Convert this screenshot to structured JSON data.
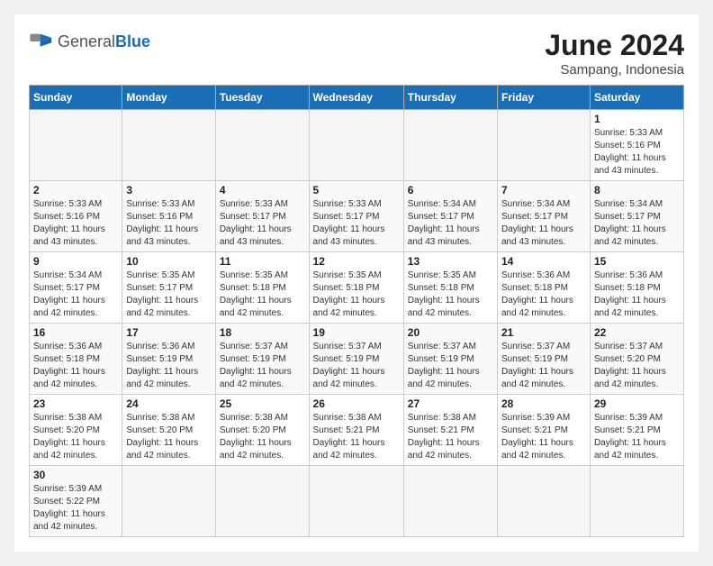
{
  "header": {
    "logo_general": "General",
    "logo_blue": "Blue",
    "month_title": "June 2024",
    "location": "Sampang, Indonesia"
  },
  "weekdays": [
    "Sunday",
    "Monday",
    "Tuesday",
    "Wednesday",
    "Thursday",
    "Friday",
    "Saturday"
  ],
  "days": [
    {
      "date": null,
      "number": "",
      "sunrise": "",
      "sunset": "",
      "daylight": ""
    },
    {
      "date": null,
      "number": "",
      "sunrise": "",
      "sunset": "",
      "daylight": ""
    },
    {
      "date": null,
      "number": "",
      "sunrise": "",
      "sunset": "",
      "daylight": ""
    },
    {
      "date": null,
      "number": "",
      "sunrise": "",
      "sunset": "",
      "daylight": ""
    },
    {
      "date": null,
      "number": "",
      "sunrise": "",
      "sunset": "",
      "daylight": ""
    },
    {
      "date": null,
      "number": "",
      "sunrise": "",
      "sunset": "",
      "daylight": ""
    },
    {
      "date": 1,
      "number": "1",
      "sunrise": "Sunrise: 5:33 AM",
      "sunset": "Sunset: 5:16 PM",
      "daylight": "Daylight: 11 hours and 43 minutes."
    },
    {
      "date": 2,
      "number": "2",
      "sunrise": "Sunrise: 5:33 AM",
      "sunset": "Sunset: 5:16 PM",
      "daylight": "Daylight: 11 hours and 43 minutes."
    },
    {
      "date": 3,
      "number": "3",
      "sunrise": "Sunrise: 5:33 AM",
      "sunset": "Sunset: 5:16 PM",
      "daylight": "Daylight: 11 hours and 43 minutes."
    },
    {
      "date": 4,
      "number": "4",
      "sunrise": "Sunrise: 5:33 AM",
      "sunset": "Sunset: 5:17 PM",
      "daylight": "Daylight: 11 hours and 43 minutes."
    },
    {
      "date": 5,
      "number": "5",
      "sunrise": "Sunrise: 5:33 AM",
      "sunset": "Sunset: 5:17 PM",
      "daylight": "Daylight: 11 hours and 43 minutes."
    },
    {
      "date": 6,
      "number": "6",
      "sunrise": "Sunrise: 5:34 AM",
      "sunset": "Sunset: 5:17 PM",
      "daylight": "Daylight: 11 hours and 43 minutes."
    },
    {
      "date": 7,
      "number": "7",
      "sunrise": "Sunrise: 5:34 AM",
      "sunset": "Sunset: 5:17 PM",
      "daylight": "Daylight: 11 hours and 43 minutes."
    },
    {
      "date": 8,
      "number": "8",
      "sunrise": "Sunrise: 5:34 AM",
      "sunset": "Sunset: 5:17 PM",
      "daylight": "Daylight: 11 hours and 42 minutes."
    },
    {
      "date": 9,
      "number": "9",
      "sunrise": "Sunrise: 5:34 AM",
      "sunset": "Sunset: 5:17 PM",
      "daylight": "Daylight: 11 hours and 42 minutes."
    },
    {
      "date": 10,
      "number": "10",
      "sunrise": "Sunrise: 5:35 AM",
      "sunset": "Sunset: 5:17 PM",
      "daylight": "Daylight: 11 hours and 42 minutes."
    },
    {
      "date": 11,
      "number": "11",
      "sunrise": "Sunrise: 5:35 AM",
      "sunset": "Sunset: 5:18 PM",
      "daylight": "Daylight: 11 hours and 42 minutes."
    },
    {
      "date": 12,
      "number": "12",
      "sunrise": "Sunrise: 5:35 AM",
      "sunset": "Sunset: 5:18 PM",
      "daylight": "Daylight: 11 hours and 42 minutes."
    },
    {
      "date": 13,
      "number": "13",
      "sunrise": "Sunrise: 5:35 AM",
      "sunset": "Sunset: 5:18 PM",
      "daylight": "Daylight: 11 hours and 42 minutes."
    },
    {
      "date": 14,
      "number": "14",
      "sunrise": "Sunrise: 5:36 AM",
      "sunset": "Sunset: 5:18 PM",
      "daylight": "Daylight: 11 hours and 42 minutes."
    },
    {
      "date": 15,
      "number": "15",
      "sunrise": "Sunrise: 5:36 AM",
      "sunset": "Sunset: 5:18 PM",
      "daylight": "Daylight: 11 hours and 42 minutes."
    },
    {
      "date": 16,
      "number": "16",
      "sunrise": "Sunrise: 5:36 AM",
      "sunset": "Sunset: 5:18 PM",
      "daylight": "Daylight: 11 hours and 42 minutes."
    },
    {
      "date": 17,
      "number": "17",
      "sunrise": "Sunrise: 5:36 AM",
      "sunset": "Sunset: 5:19 PM",
      "daylight": "Daylight: 11 hours and 42 minutes."
    },
    {
      "date": 18,
      "number": "18",
      "sunrise": "Sunrise: 5:37 AM",
      "sunset": "Sunset: 5:19 PM",
      "daylight": "Daylight: 11 hours and 42 minutes."
    },
    {
      "date": 19,
      "number": "19",
      "sunrise": "Sunrise: 5:37 AM",
      "sunset": "Sunset: 5:19 PM",
      "daylight": "Daylight: 11 hours and 42 minutes."
    },
    {
      "date": 20,
      "number": "20",
      "sunrise": "Sunrise: 5:37 AM",
      "sunset": "Sunset: 5:19 PM",
      "daylight": "Daylight: 11 hours and 42 minutes."
    },
    {
      "date": 21,
      "number": "21",
      "sunrise": "Sunrise: 5:37 AM",
      "sunset": "Sunset: 5:19 PM",
      "daylight": "Daylight: 11 hours and 42 minutes."
    },
    {
      "date": 22,
      "number": "22",
      "sunrise": "Sunrise: 5:37 AM",
      "sunset": "Sunset: 5:20 PM",
      "daylight": "Daylight: 11 hours and 42 minutes."
    },
    {
      "date": 23,
      "number": "23",
      "sunrise": "Sunrise: 5:38 AM",
      "sunset": "Sunset: 5:20 PM",
      "daylight": "Daylight: 11 hours and 42 minutes."
    },
    {
      "date": 24,
      "number": "24",
      "sunrise": "Sunrise: 5:38 AM",
      "sunset": "Sunset: 5:20 PM",
      "daylight": "Daylight: 11 hours and 42 minutes."
    },
    {
      "date": 25,
      "number": "25",
      "sunrise": "Sunrise: 5:38 AM",
      "sunset": "Sunset: 5:20 PM",
      "daylight": "Daylight: 11 hours and 42 minutes."
    },
    {
      "date": 26,
      "number": "26",
      "sunrise": "Sunrise: 5:38 AM",
      "sunset": "Sunset: 5:21 PM",
      "daylight": "Daylight: 11 hours and 42 minutes."
    },
    {
      "date": 27,
      "number": "27",
      "sunrise": "Sunrise: 5:38 AM",
      "sunset": "Sunset: 5:21 PM",
      "daylight": "Daylight: 11 hours and 42 minutes."
    },
    {
      "date": 28,
      "number": "28",
      "sunrise": "Sunrise: 5:39 AM",
      "sunset": "Sunset: 5:21 PM",
      "daylight": "Daylight: 11 hours and 42 minutes."
    },
    {
      "date": 29,
      "number": "29",
      "sunrise": "Sunrise: 5:39 AM",
      "sunset": "Sunset: 5:21 PM",
      "daylight": "Daylight: 11 hours and 42 minutes."
    },
    {
      "date": 30,
      "number": "30",
      "sunrise": "Sunrise: 5:39 AM",
      "sunset": "Sunset: 5:22 PM",
      "daylight": "Daylight: 11 hours and 42 minutes."
    }
  ]
}
